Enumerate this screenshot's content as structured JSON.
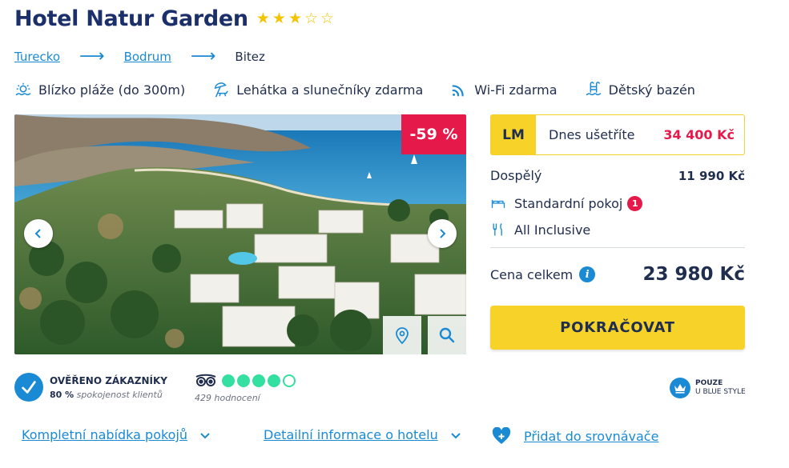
{
  "hotel": {
    "name": "Hotel Natur Garden",
    "stars_filled": 3,
    "stars_total": 5
  },
  "breadcrumb": [
    "Turecko",
    "Bodrum",
    "Bitez"
  ],
  "features": [
    {
      "icon": "beach-icon",
      "label": "Blízko pláže (do 300m)"
    },
    {
      "icon": "sunbed-umbrella-icon",
      "label": "Lehátka a slunečníky zdarma"
    },
    {
      "icon": "wifi-icon",
      "label": "Wi-Fi zdarma"
    },
    {
      "icon": "pool-icon",
      "label": "Dětský bazén"
    }
  ],
  "gallery": {
    "discount": "-59 %"
  },
  "price": {
    "lm_badge": "LM",
    "save_label": "Dnes ušetříte",
    "save_amount": "34 400 Kč",
    "adults_label": "Dospělý",
    "adults_amount": "11 990 Kč",
    "room_label": "Standardní pokoj",
    "room_count": "1",
    "board_label": "All Inclusive",
    "total_label": "Cena celkem",
    "total_amount": "23 980 Kč",
    "continue_label": "POKRAČOVAT"
  },
  "reviews": {
    "verified_title": "OVĚŘENO ZÁKAZNÍKY",
    "satisfaction_value": "80 %",
    "satisfaction_label": "spokojenost klientů",
    "tripadvisor_rating": 4,
    "tripadvisor_max": 5,
    "tripadvisor_count": "429 hodnocení"
  },
  "blue_style": {
    "line1": "POUZE",
    "line2": "U BLUE STYLE"
  },
  "links": {
    "rooms": "Kompletní nabídka pokojů",
    "details": "Detailní informace o hotelu",
    "compare": "Přidat do srovnávače"
  },
  "colors": {
    "brand_blue": "#1a8ad4",
    "title_navy": "#1b2f6b",
    "accent_yellow": "#f7d32a",
    "discount_red": "#e6194b",
    "tripadvisor_green": "#34e0a1"
  }
}
